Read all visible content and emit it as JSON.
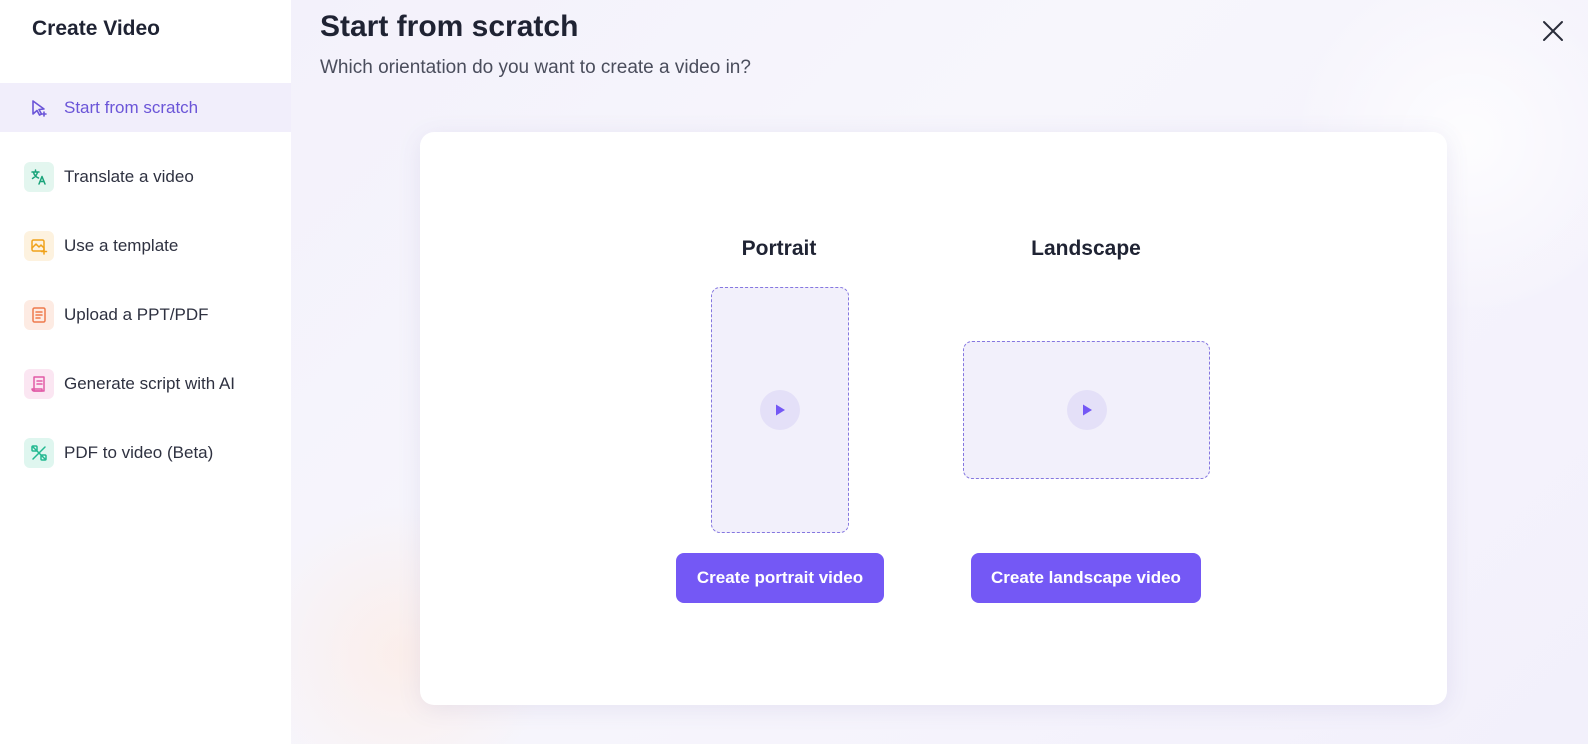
{
  "sidebar": {
    "title": "Create Video",
    "items": [
      {
        "label": "Start from scratch",
        "icon": "cursor-plus-icon",
        "color": "#6b55d8",
        "active": true
      },
      {
        "label": "Translate a video",
        "icon": "translate-icon",
        "color": "#1aa37a"
      },
      {
        "label": "Use a template",
        "icon": "template-icon",
        "color": "#f0a21a"
      },
      {
        "label": "Upload a PPT/PDF",
        "icon": "document-icon",
        "color": "#ee7a4c"
      },
      {
        "label": "Generate script with AI",
        "icon": "script-icon",
        "color": "#e15aa6"
      },
      {
        "label": "PDF to video (Beta)",
        "icon": "pdf-video-icon",
        "color": "#22b890"
      }
    ]
  },
  "main": {
    "title": "Start from scratch",
    "subtitle": "Which orientation do you want to create a video in?",
    "close_icon": "close-icon"
  },
  "options": {
    "portrait": {
      "label": "Portrait",
      "button": "Create portrait video"
    },
    "landscape": {
      "label": "Landscape",
      "button": "Create landscape video"
    }
  },
  "colors": {
    "accent": "#7458f5",
    "preview_border": "#8577e0",
    "preview_bg": "#f2f0fb",
    "active_nav_bg": "#f1eefb"
  }
}
